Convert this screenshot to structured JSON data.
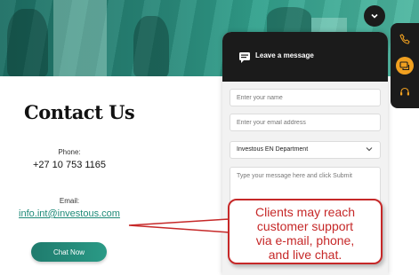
{
  "contact": {
    "title": "Contact Us",
    "phone_label": "Phone:",
    "phone_value": "+27 10 753 1165",
    "email_label": "Email:",
    "email_value": "info.int@investous.com",
    "chat_button": "Chat Now"
  },
  "chat_panel": {
    "title": "Leave a message",
    "name_placeholder": "Enter your name",
    "email_placeholder": "Enter your email address",
    "department_selected": "Investous EN Department",
    "message_placeholder": "Type your message here and click Submit"
  },
  "annotation": {
    "line1": "Clients may reach",
    "line2": "customer support",
    "line3": "via e-mail, phone,",
    "line4": "and live chat."
  },
  "colors": {
    "accent": "#2a9a86",
    "panel_dark": "#1b1b1b",
    "annotation": "#c62828",
    "rail_active": "#f0a020"
  },
  "icons": {
    "close": "chevron-down-icon",
    "phone": "phone-icon",
    "chat": "chat-bubble-icon",
    "support": "headset-icon",
    "message": "message-icon",
    "select_caret": "chevron-down-icon"
  }
}
